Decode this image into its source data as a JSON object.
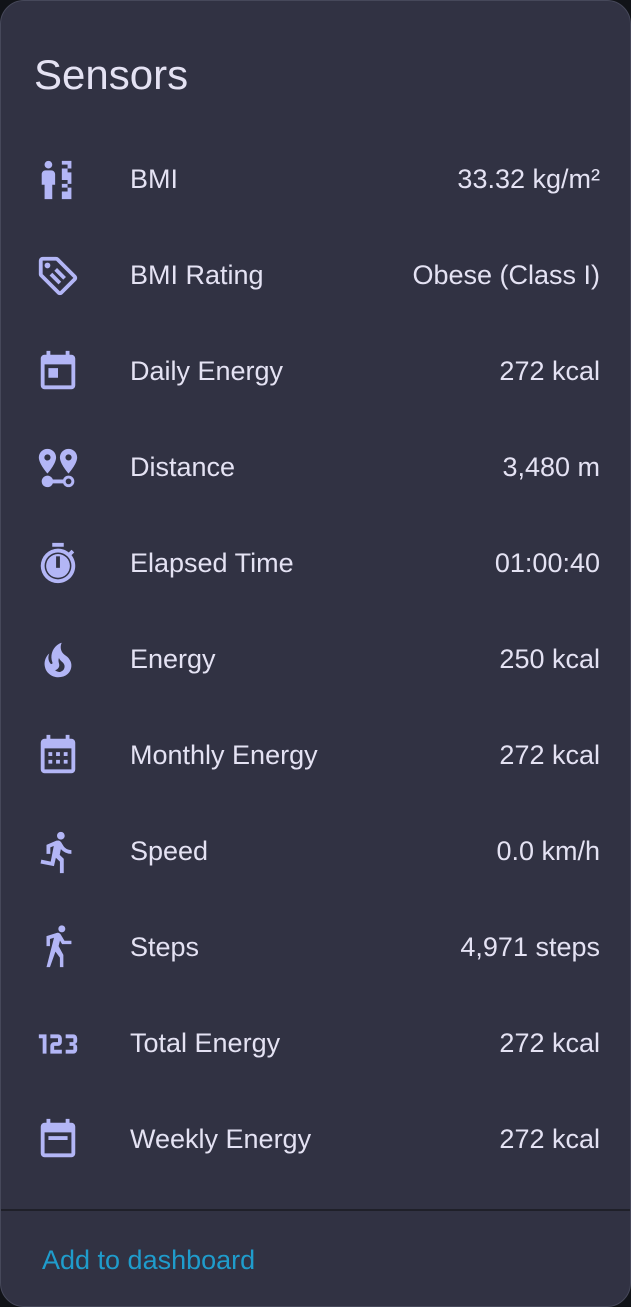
{
  "card": {
    "title": "Sensors",
    "add_button_label": "Add to dashboard"
  },
  "colors": {
    "background": "#313243",
    "icon": "#b3b6f6",
    "text": "#e4e2f3",
    "accent": "#1f9ccc"
  },
  "sensors": [
    {
      "icon": "human-height-icon",
      "name": "BMI",
      "value": "33.32 kg/m²"
    },
    {
      "icon": "tag-icon",
      "name": "BMI Rating",
      "value": "Obese (Class I)"
    },
    {
      "icon": "calendar-today-icon",
      "name": "Daily Energy",
      "value": "272 kcal"
    },
    {
      "icon": "map-marker-distance-icon",
      "name": "Distance",
      "value": "3,480 m"
    },
    {
      "icon": "timer-icon",
      "name": "Elapsed Time",
      "value": "01:00:40"
    },
    {
      "icon": "fire-icon",
      "name": "Energy",
      "value": "250 kcal"
    },
    {
      "icon": "calendar-month-icon",
      "name": "Monthly Energy",
      "value": "272 kcal"
    },
    {
      "icon": "run-icon",
      "name": "Speed",
      "value": "0.0 km/h"
    },
    {
      "icon": "walk-icon",
      "name": "Steps",
      "value": "4,971 steps"
    },
    {
      "icon": "numeric-icon",
      "name": "Total Energy",
      "value": "272 kcal"
    },
    {
      "icon": "calendar-week-icon",
      "name": "Weekly Energy",
      "value": "272 kcal"
    }
  ]
}
